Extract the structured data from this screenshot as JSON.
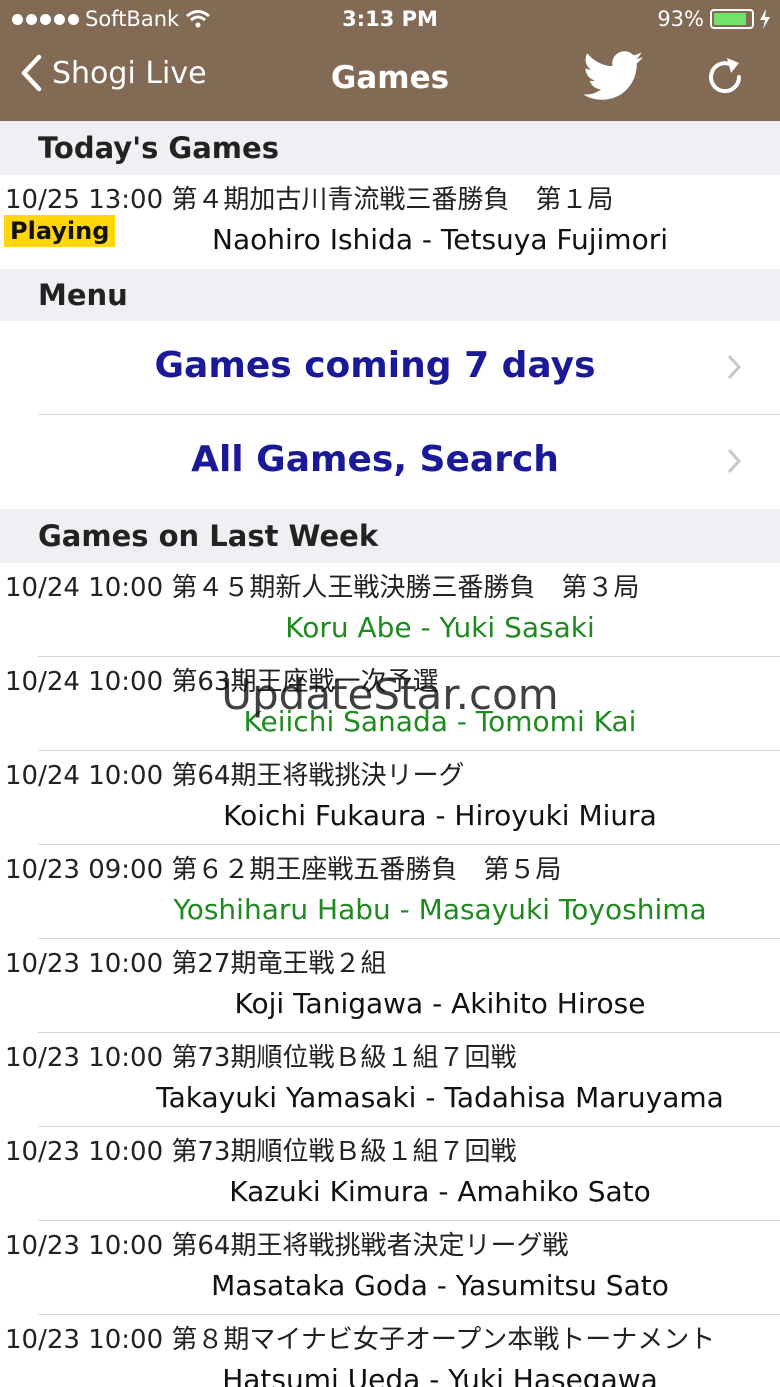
{
  "status_bar": {
    "carrier": "SoftBank",
    "time": "3:13 PM",
    "battery": "93%"
  },
  "nav": {
    "back_label": "Shogi Live",
    "title": "Games",
    "twitter_icon": "twitter-bird-icon",
    "refresh_icon": "refresh-icon"
  },
  "sections": {
    "today": "Today's Games",
    "menu": "Menu",
    "last_week": "Games on Last Week"
  },
  "today_games": [
    {
      "meta": "10/25 13:00 第４期加古川青流戦三番勝負　第１局",
      "players": "Naohiro Ishida - Tetsuya Fujimori",
      "badge": "Playing"
    }
  ],
  "menu": {
    "items": [
      {
        "label": "Games coming 7 days"
      },
      {
        "label": "All Games, Search"
      }
    ]
  },
  "last_week_games": [
    {
      "meta": "10/24 10:00 第４５期新人王戦決勝三番勝負　第３局",
      "players": "Koru Abe - Yuki Sasaki",
      "green": true
    },
    {
      "meta": "10/24 10:00 第63期王座戦一次予選",
      "players": "Keiichi Sanada - Tomomi Kai",
      "green": true
    },
    {
      "meta": "10/24 10:00 第64期王将戦挑決リーグ",
      "players": "Koichi Fukaura - Hiroyuki Miura",
      "green": false
    },
    {
      "meta": "10/23 09:00 第６２期王座戦五番勝負　第５局",
      "players": "Yoshiharu Habu - Masayuki Toyoshima",
      "green": true
    },
    {
      "meta": "10/23 10:00 第27期竜王戦２組",
      "players": "Koji Tanigawa - Akihito Hirose",
      "green": false
    },
    {
      "meta": "10/23 10:00 第73期順位戦Ｂ級１組７回戦",
      "players": "Takayuki Yamasaki - Tadahisa Maruyama",
      "green": false
    },
    {
      "meta": "10/23 10:00 第73期順位戦Ｂ級１組７回戦",
      "players": "Kazuki Kimura - Amahiko Sato",
      "green": false
    },
    {
      "meta": "10/23 10:00 第64期王将戦挑戦者決定リーグ戦",
      "players": "Masataka Goda - Yasumitsu Sato",
      "green": false
    },
    {
      "meta": "10/23 10:00 第８期マイナビ女子オープン本戦トーナメント",
      "players": "Hatsumi Ueda - Yuki Hasegawa",
      "green": false
    }
  ],
  "watermark": "UpdateStar.com",
  "colors": {
    "nav_bg": "#826a54",
    "section_bg": "#efeff4",
    "menu_text": "#1a1a99",
    "green_players": "#1f8a1f",
    "badge_bg": "#ffd60a"
  }
}
